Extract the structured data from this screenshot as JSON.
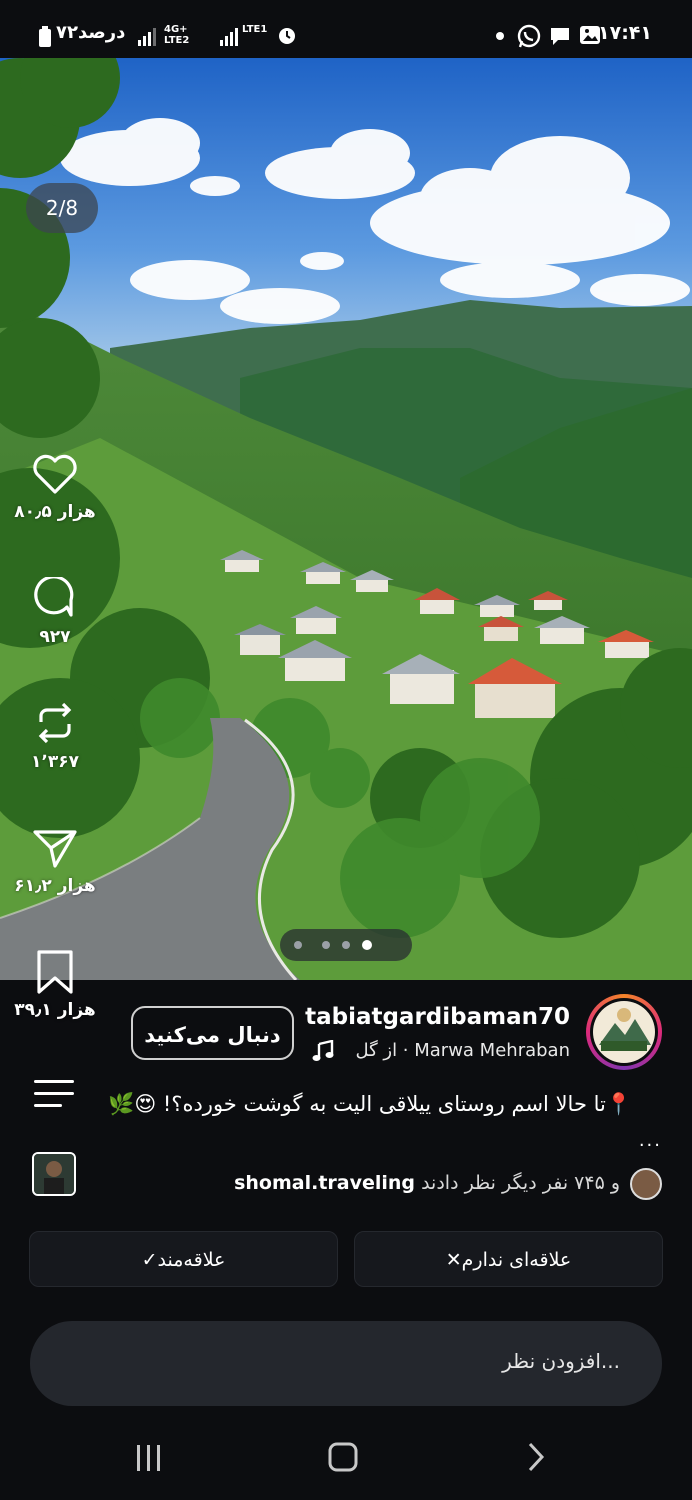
{
  "status_bar": {
    "time": "۱۷:۴۱",
    "battery": "۷۲درصد",
    "net1": "4G+ LTE2",
    "net2": "LTE1"
  },
  "post": {
    "image_counter": "2/8",
    "actions": {
      "likes": "۸۰٫۵ هزار",
      "comments": "۹۲۷",
      "reposts": "۱٬۳۶۷",
      "shares": "۶۱٫۲ هزار",
      "saves": "۳۹٫۱ هزار"
    },
    "carousel": {
      "count": 4,
      "active_index": 3
    },
    "username": "tabiatgardibaman70",
    "follow_label": "دنبال می‌کنید",
    "music_text": "از گل · Marwa Mehraban",
    "caption": "📍تا حالا اسم روستای ییلاقی الیت به گوشت خورده؟! 😍🌿",
    "more": "...",
    "liked_by": {
      "user": "shomal.traveling",
      "text": "و ۷۴۵ نفر دیگر نظر دادند"
    },
    "interested_label": "✓علاقه‌مند",
    "not_interested_label": "✕علاقه‌ای ندارم",
    "comment_placeholder": "افزودن نظر..."
  },
  "colors": {
    "background": "#0c0d10",
    "pill": "#16181d",
    "comment_box": "#24272d"
  },
  "icons": [
    "heart-icon",
    "comment-icon",
    "repost-icon",
    "share-icon",
    "bookmark-icon",
    "music-icon",
    "menu-icon",
    "recents-icon",
    "home-icon",
    "back-icon"
  ]
}
